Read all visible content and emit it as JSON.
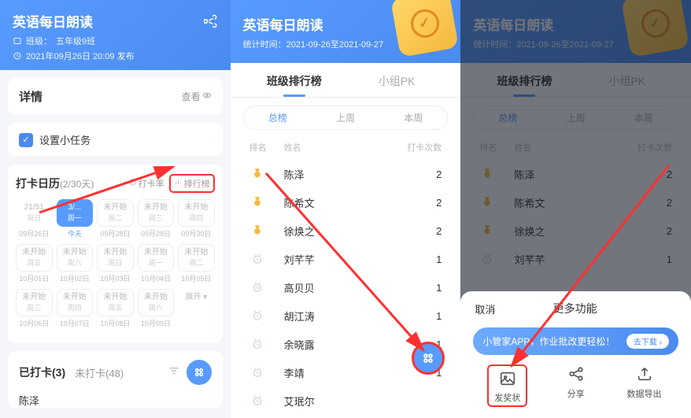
{
  "p1": {
    "title": "英语每日朗读",
    "class_label": "班级：",
    "class_value": "五年级9班",
    "publish": "2021年09月26日 20:09 发布",
    "detail": "详情",
    "more": "查看",
    "task": "设置小任务",
    "calendar": {
      "title": "打卡日历",
      "days": "(2/30天)",
      "tab_rate": "打卡率",
      "tab_rank": "排行榜",
      "row1": [
        {
          "top": "21/51",
          "bottom": "周日"
        },
        {
          "top": "3/...",
          "bottom": "周一"
        },
        {
          "top": "未开始",
          "bottom": "周二"
        },
        {
          "top": "未开始",
          "bottom": "周三"
        },
        {
          "top": "未开始",
          "bottom": "周四"
        }
      ],
      "dates1": [
        "09月26日",
        "今天",
        "09月28日",
        "09月29日",
        "09月30日"
      ],
      "row2": [
        {
          "top": "未开始",
          "bottom": "周五"
        },
        {
          "top": "未开始",
          "bottom": "周六"
        },
        {
          "top": "未开始",
          "bottom": "周日"
        },
        {
          "top": "未开始",
          "bottom": "周一"
        },
        {
          "top": "未开始",
          "bottom": "周二"
        }
      ],
      "dates2": [
        "10月01日",
        "10月02日",
        "10月03日",
        "10月04日",
        "10月05日"
      ],
      "row3": [
        {
          "top": "未开始",
          "bottom": "周三"
        },
        {
          "top": "未开始",
          "bottom": "周四"
        },
        {
          "top": "未开始",
          "bottom": "周五"
        },
        {
          "top": "未开始",
          "bottom": "周六"
        }
      ],
      "expand": "展开",
      "dates3": [
        "10月06日",
        "10月07日",
        "10月08日",
        "10月09日"
      ]
    },
    "signed": {
      "tab_done": "已打卡(3)",
      "tab_undone": "未打卡(48)",
      "name": "陈泽"
    }
  },
  "p2": {
    "title": "英语每日朗读",
    "sub": "统计时间：2021-09-26至2021-09-27",
    "tabs": {
      "rank": "班级排行榜",
      "pk": "小组PK"
    },
    "subtabs": {
      "all": "总榜",
      "last": "上周",
      "this": "本周"
    },
    "header": {
      "rank": "排名",
      "name": "姓名",
      "count": "打卡次数"
    },
    "rows": [
      {
        "name": "陈泽",
        "count": "2",
        "badge": "gold"
      },
      {
        "name": "陈希文",
        "count": "2",
        "badge": "gold"
      },
      {
        "name": "徐焕之",
        "count": "2",
        "badge": "gold"
      },
      {
        "name": "刘芊芊",
        "count": "1",
        "badge": "silver"
      },
      {
        "name": "高贝贝",
        "count": "1",
        "badge": "silver"
      },
      {
        "name": "胡江涛",
        "count": "1",
        "badge": "silver"
      },
      {
        "name": "余晓露",
        "count": "1",
        "badge": "silver"
      },
      {
        "name": "李靖",
        "count": "1",
        "badge": "silver"
      },
      {
        "name": "艾珉尔",
        "count": "",
        "badge": "silver"
      }
    ]
  },
  "p3sheet": {
    "cancel": "取消",
    "title": "更多功能",
    "banner": "小管家APP，作业批改更轻松！",
    "banner_btn": "去下载",
    "actions": [
      {
        "label": "发奖状"
      },
      {
        "label": "分享"
      },
      {
        "label": "数据导出"
      }
    ]
  }
}
